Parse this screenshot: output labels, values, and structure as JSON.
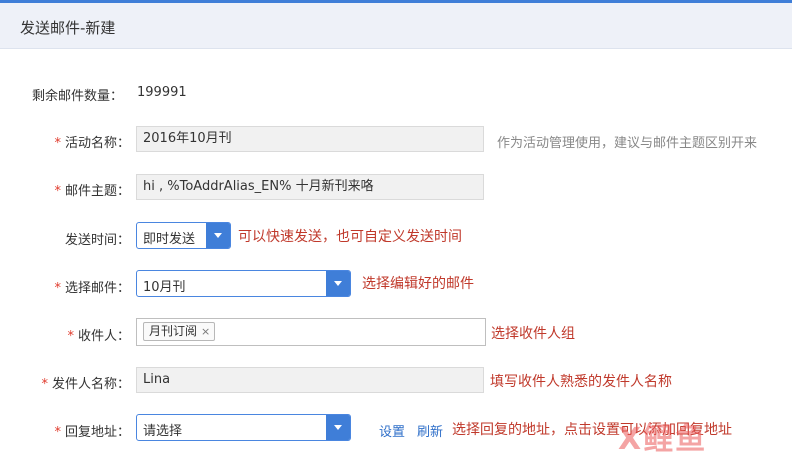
{
  "header": {
    "title": "发送邮件-新建"
  },
  "quota": {
    "label": "剩余邮件数量：",
    "value": "199991"
  },
  "required_mark": "*",
  "activity": {
    "label": "活动名称：",
    "value": "2016年10月刊",
    "hint": "作为活动管理使用，建议与邮件主题区别开来"
  },
  "subject": {
    "label": "邮件主题：",
    "value": "hi , %ToAddrAlias_EN% 十月新刊来咯"
  },
  "send_time": {
    "label": "发送时间：",
    "value": "即时发送",
    "hint": "可以快速发送，也可自定义发送时间"
  },
  "choose_mail": {
    "label": "选择邮件：",
    "value": "10月刊",
    "hint": "选择编辑好的邮件"
  },
  "recipients": {
    "label": "收件人：",
    "tag": "月刊订阅",
    "tag_remove": "×",
    "hint": "选择收件人组"
  },
  "sender_name": {
    "label": "发件人名称：",
    "value": "Lina",
    "hint": "填写收件人熟悉的发件人名称"
  },
  "reply_addr": {
    "label": "回复地址：",
    "value": "请选择",
    "settings_link": "设置",
    "refresh_link": "刷新",
    "hint": "选择回复的地址，点击设置可以添加回复地址"
  },
  "watermark": "X鲤鱼",
  "colors": {
    "accent": "#3f7ed8",
    "required": "#e0392b",
    "hint_red": "#c0392b",
    "hint_gray": "#888888",
    "link": "#2f6fc9"
  }
}
